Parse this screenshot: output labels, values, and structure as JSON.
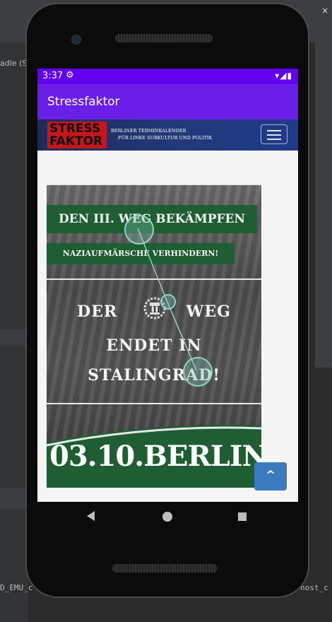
{
  "ide": {
    "left_tab_text": "adle (S",
    "bottom_left_text": "D_EMU_c",
    "bottom_right_text": "host_c",
    "close_glyph": "×"
  },
  "status_bar": {
    "time": "3:37",
    "icons": [
      "gear-icon",
      "wifi-icon",
      "signal-icon",
      "battery-icon"
    ]
  },
  "app_bar": {
    "title": "Stressfaktor"
  },
  "site_header": {
    "logo_line1": "STRESS",
    "logo_line2": "FAKTOR",
    "tagline_line1": "BERLINER TERMINKALENDER",
    "tagline_line2": "FÜR LINKE SUBKULTUR UND POLITIK",
    "logo_color": "#c4161c",
    "header_color": "#1f3370"
  },
  "poster": {
    "banner1": "DEN III. WEG BEKÄMPFEN",
    "banner2": "NAZIAUFMÄRSCHE VERHINDERN!",
    "line1_left": "DER",
    "line1_right": "WEG",
    "emblem": "III",
    "line2": "ENDET IN",
    "line3": "STALINGRAD!",
    "date_line": "03.10.BERLIN",
    "green": "#1f5e33"
  },
  "scroll_top": {
    "icon": "chevron-up-icon",
    "glyph": "^"
  },
  "navigation_bar": {
    "buttons": [
      "back-icon",
      "home-icon",
      "recents-icon"
    ]
  }
}
